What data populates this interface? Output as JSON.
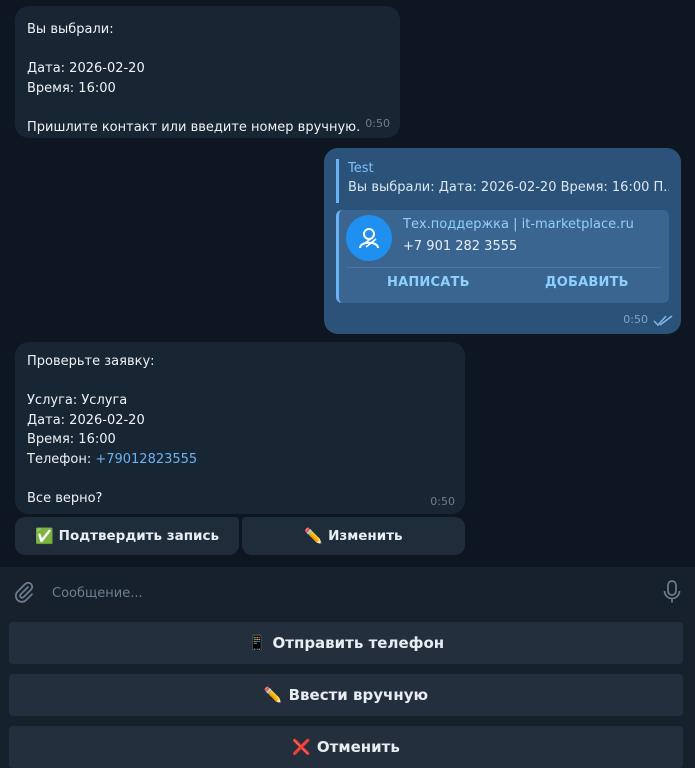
{
  "messages": {
    "m1": {
      "text": "Вы выбрали:\n\nДата: 2026-02-20\nВремя: 16:00\n\nПришлите контакт или введите номер вручную.",
      "time": "0:50"
    },
    "m2": {
      "quote_author": "Test",
      "quote_text": "Вы выбрали:  Дата: 2026-02-20 Время: 16:00  П...",
      "contact_name": "Тех.поддержка | it-marketplace.ru",
      "contact_phone": "+7 901 282 3555",
      "write_label": "НАПИСАТЬ",
      "add_label": "ДОБАВИТЬ",
      "time": "0:50",
      "status_icon": "double-check-icon"
    },
    "m3": {
      "text_before": "Проверьте заявку:\n\nУслуга: Услуга\nДата: 2026-02-20\nВремя: 16:00\nТелефон: ",
      "phone": "+79012823555",
      "text_after": "\n\nВсе верно?",
      "time": "0:50"
    }
  },
  "inline_buttons": {
    "confirm": {
      "emoji": "✅",
      "label": "Подтвердить запись"
    },
    "edit": {
      "emoji": "✏️",
      "label": "Изменить"
    }
  },
  "composer": {
    "placeholder": "Сообщение...",
    "attach_icon": "paperclip-icon",
    "mic_icon": "microphone-icon"
  },
  "keyboard": {
    "phone": {
      "emoji": "📱",
      "label": "Отправить телефон"
    },
    "manual": {
      "emoji": "✏️",
      "label": "Ввести вручную"
    },
    "cancel": {
      "emoji": "❌",
      "label": "Отменить"
    }
  },
  "colors": {
    "background": "#0e1621",
    "incoming_bubble": "#182533",
    "outgoing_bubble": "#2b5278",
    "accent": "#6ab2f2"
  }
}
